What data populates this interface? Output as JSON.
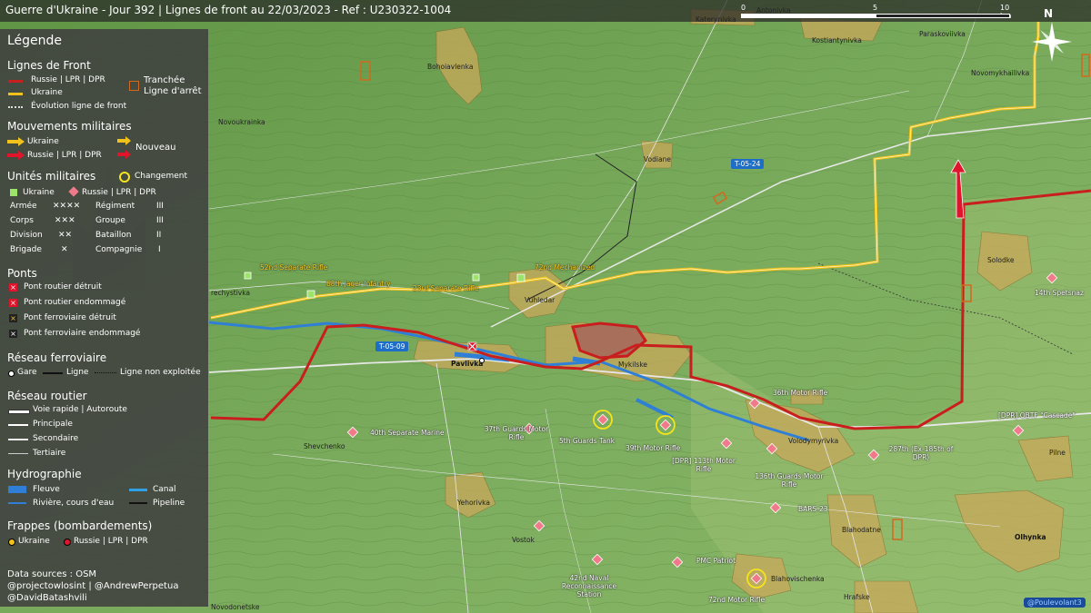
{
  "title": "Guerre d'Ukraine - Jour 392 | Lignes de front au 22/03/2023 - Ref : U230322-1004",
  "scale": {
    "labels": [
      "0",
      "5",
      "10 km"
    ]
  },
  "north_label": "N",
  "legend": {
    "title": "Légende",
    "front": {
      "title": "Lignes de Front",
      "russia": "Russie | LPR | DPR",
      "ukraine": "Ukraine",
      "evolution": "Évolution ligne de front",
      "trench": "Tranchée",
      "stop_line": "Ligne d'arrêt"
    },
    "movements": {
      "title": "Mouvements militaires",
      "ukraine": "Ukraine",
      "russia": "Russie | LPR | DPR",
      "new": "Nouveau"
    },
    "units": {
      "title": "Unités militaires",
      "change": "Changement",
      "ukraine": "Ukraine",
      "russia": "Russie | LPR | DPR",
      "sizes": [
        {
          "label": "Armée",
          "symbol": "✕✕✕✕"
        },
        {
          "label": "Corps",
          "symbol": "✕✕✕"
        },
        {
          "label": "Division",
          "symbol": "✕✕"
        },
        {
          "label": "Brigade",
          "symbol": "✕"
        },
        {
          "label": "Régiment",
          "symbol": "III"
        },
        {
          "label": "Groupe",
          "symbol": "III"
        },
        {
          "label": "Bataillon",
          "symbol": "II"
        },
        {
          "label": "Compagnie",
          "symbol": "I"
        }
      ]
    },
    "bridges": {
      "title": "Ponts",
      "items": [
        "Pont routier détruit",
        "Pont routier endommagé",
        "Pont ferroviaire détruit",
        "Pont ferroviaire endommagé"
      ]
    },
    "rail": {
      "title": "Réseau ferroviaire",
      "station": "Gare",
      "line": "Ligne",
      "unused": "Ligne non exploitée"
    },
    "roads": {
      "title": "Réseau routier",
      "items": [
        "Voie rapide | Autoroute",
        "Principale",
        "Secondaire",
        "Tertiaire"
      ]
    },
    "hydro": {
      "title": "Hydrographie",
      "river": "Fleuve",
      "stream": "Rivière, cours d'eau",
      "canal": "Canal",
      "pipeline": "Pipeline"
    },
    "strikes": {
      "title": "Frappes (bombardements)",
      "ukraine": "Ukraine",
      "russia": "Russie | LPR | DPR"
    },
    "sources": [
      "Data sources : OSM",
      "@projectowlosint | @AndrewPerpetua",
      "@DavidBatashvili"
    ]
  },
  "towns": {
    "katerynivka": "Katerynivka",
    "antonivka": "Antonivka",
    "kostiantynivka": "Kostiantynivka",
    "paraskoviivka": "Paraskoviivka",
    "novomykhailivka": "Novomykhailivka",
    "bohoiavlenka": "Bohoiavlenka",
    "novoukrainka": "Novoukrainka",
    "vodiane": "Vodiane",
    "solodke": "Solodke",
    "prechystivka": "rechystivka",
    "vuhledar": "Vuhledar",
    "pavlivka": "Pavlivka",
    "mykilske": "Mykilske",
    "volodymyrivka": "Volodymyrivka",
    "pilne": "Pilne",
    "shevchenko": "Shevchenko",
    "yehorivka": "Yehorivka",
    "vostok": "Vostok",
    "blahodatne": "Blahodatne",
    "olhynka": "Olhynka",
    "blahovischenka": "Blahovischenka",
    "hrafske": "Hrafske",
    "novodonetske": "Novodonetske"
  },
  "roads": {
    "t0524": "T-05-24",
    "t0509": "T-05-09"
  },
  "units_ua": [
    "52nd Separate Rifle",
    "68th Jager Infantry",
    "23rd Separate Rifle",
    "72nd Mechanized"
  ],
  "units_ru": [
    "14th Spetsnaz",
    "36th Motor Rifle",
    "[DPR] OBTF \"Cascade\"",
    "40th Separate Marine",
    "37th Guards Motor Rifle",
    "5th Guards Tank",
    "39th Motor Rifle",
    "[DPR] 113th Motor Rifle",
    "136th Guards Motor Rifle",
    "287th (Ex-185th of DPR)",
    "BARS-23",
    "PMC Patriot",
    "42nd Naval Reconnaissance Station",
    "72nd Motor Rifle"
  ],
  "credit": "@Poulevolant3",
  "colors": {
    "russia": "#c81e1e",
    "ukraine": "#f2c21c",
    "ua_unit": "#9be36b",
    "ru_unit": "#f07a8a",
    "river": "#2f7fd6"
  }
}
